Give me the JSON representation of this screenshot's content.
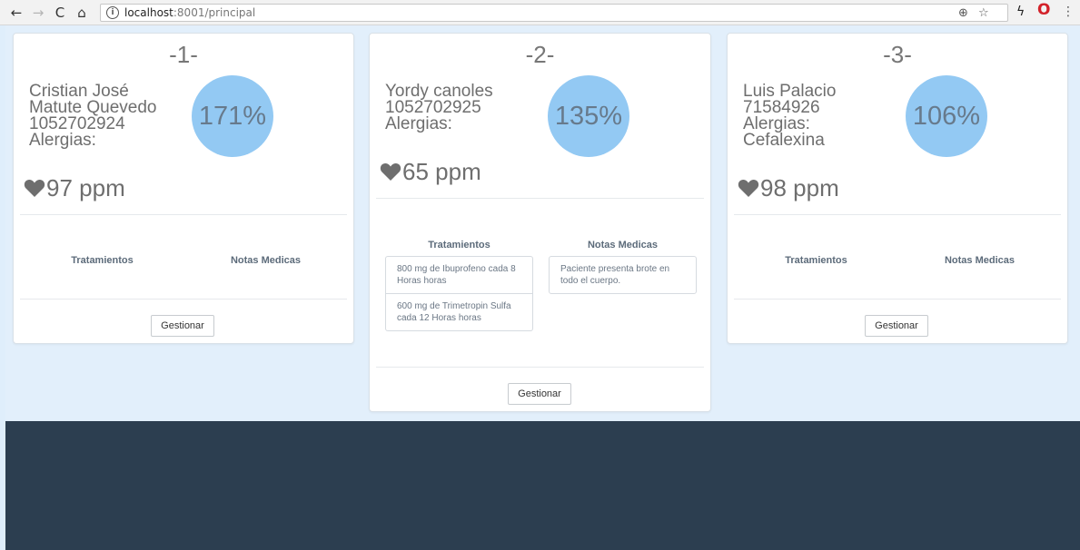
{
  "browser": {
    "url_host": "localhost",
    "url_rest": ":8001/principal"
  },
  "patients": [
    {
      "number": "-1-",
      "name_line1": "Cristian José",
      "name_line2": "Matute Quevedo",
      "id": "1052702924",
      "allergies_label": "Alergias:",
      "allergies": "",
      "percent": "171%",
      "bpm": "97 ppm",
      "treatments_label": "Tratamientos",
      "notes_label": "Notas Medicas",
      "treatments": [],
      "notes": [],
      "button_label": "Gestionar"
    },
    {
      "number": "-2-",
      "name_line1": "Yordy canoles",
      "id": "1052702925",
      "allergies_label": "Alergias:",
      "allergies": "",
      "percent": "135%",
      "bpm": "65 ppm",
      "treatments_label": "Tratamientos",
      "notes_label": "Notas Medicas",
      "treatments": [
        "800 mg de Ibuprofeno cada 8 Horas horas",
        "600 mg de Trimetropin Sulfa cada 12 Horas horas"
      ],
      "notes": [
        "Paciente presenta brote en todo el cuerpo."
      ],
      "button_label": "Gestionar"
    },
    {
      "number": "-3-",
      "name_line1": "Luis Palacio",
      "id": "71584926",
      "allergies_label": "Alergias:",
      "allergies": "Cefalexina",
      "percent": "106%",
      "bpm": "98 ppm",
      "treatments_label": "Tratamientos",
      "notes_label": "Notas Medicas",
      "treatments": [],
      "notes": [],
      "button_label": "Gestionar"
    }
  ],
  "icons": {
    "back": "back-arrow-icon",
    "forward": "forward-arrow-icon",
    "reload": "reload-icon",
    "home": "home-icon",
    "info": "info-icon",
    "zoom": "zoom-icon",
    "bookmark": "star-icon",
    "extension": "lightning-icon",
    "opera": "opera-icon",
    "menu": "menu-icon",
    "heart": "heart-icon"
  },
  "colors": {
    "page_bg": "#e2effb",
    "footer_bg": "#2c3e50",
    "circle": "#93c9f3",
    "opera_red": "#d3222a"
  }
}
